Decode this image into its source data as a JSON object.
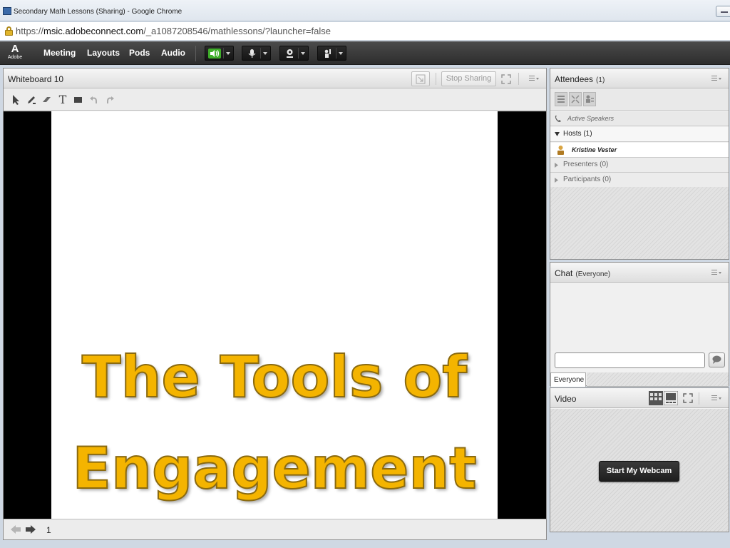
{
  "browser": {
    "window_title": "Secondary Math Lessons (Sharing) - Google Chrome",
    "url_scheme": "https://",
    "url_host": "msic.adobeconnect.com",
    "url_path": "/_a1087208546/mathlessons/?launcher=false"
  },
  "appbar": {
    "logo_mark": "A",
    "logo_word": "Adobe",
    "menu": [
      "Meeting",
      "Layouts",
      "Pods",
      "Audio"
    ]
  },
  "whiteboard": {
    "title": "Whiteboard 10",
    "stop_sharing_label": "Stop Sharing",
    "tools": {
      "text_tool": "T"
    },
    "slide_line1": "The Tools of",
    "slide_line2": "Engagement",
    "page_number": "1",
    "title_color": "#f4b400"
  },
  "attendees": {
    "title": "Attendees",
    "count": "(1)",
    "active_speakers_label": "Active Speakers",
    "hosts_label": "Hosts (1)",
    "host_name": "Kristine Vester",
    "presenters_label": "Presenters (0)",
    "participants_label": "Participants (0)"
  },
  "chat": {
    "title": "Chat",
    "scope": "(Everyone)",
    "input_value": "",
    "tab_label": "Everyone"
  },
  "video": {
    "title": "Video",
    "start_webcam_label": "Start My Webcam"
  }
}
